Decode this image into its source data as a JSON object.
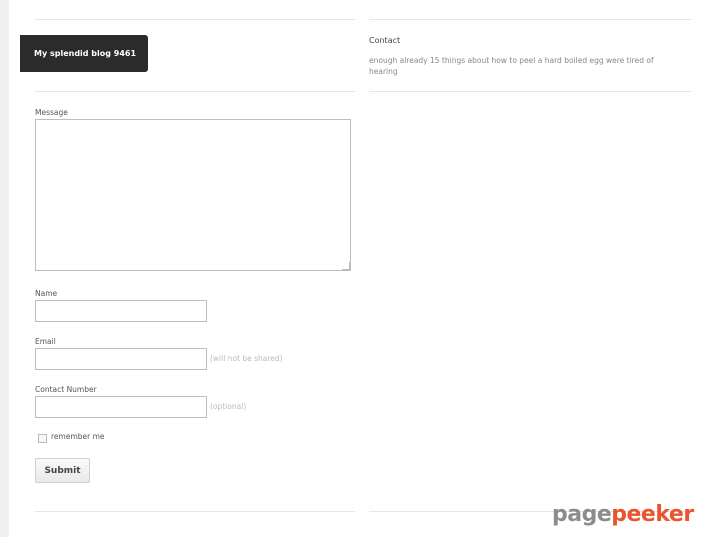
{
  "sidebar": {
    "blog_title": "My splendid blog 9461"
  },
  "widget": {
    "heading": "Contact",
    "text": "enough already 15 things about how to peel a hard boiled egg were tired of hearing"
  },
  "form": {
    "message_label": "Message",
    "message_value": "",
    "name_label": "Name",
    "name_value": "",
    "email_label": "Email",
    "email_value": "",
    "email_hint": "(will not be shared)",
    "phone_label": "Contact Number",
    "phone_value": "",
    "phone_hint": "(optional)",
    "remember_label": "remember me",
    "remember_checked": false,
    "submit_label": "Submit"
  },
  "watermark": {
    "part1": "page",
    "part2": "peeker",
    "colors": {
      "part1": "#8c8c8c",
      "part2": "#e8552e"
    }
  }
}
